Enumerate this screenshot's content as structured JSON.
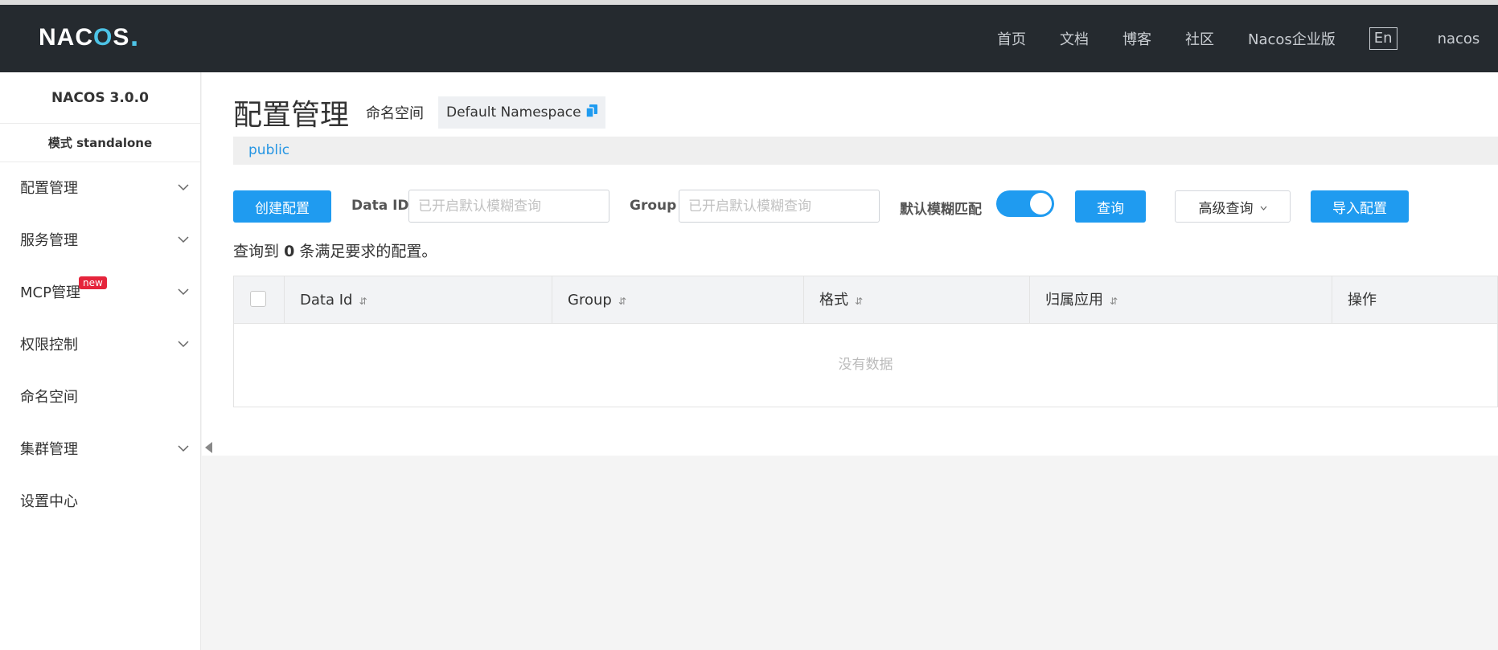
{
  "header": {
    "logo": "NACOS.",
    "nav": [
      "首页",
      "文档",
      "博客",
      "社区",
      "Nacos企业版"
    ],
    "lang": "En",
    "user": "nacos"
  },
  "sidebar": {
    "version": "NACOS 3.0.0",
    "mode": "模式 standalone",
    "items": [
      {
        "label": "配置管理",
        "expandable": true
      },
      {
        "label": "服务管理",
        "expandable": true
      },
      {
        "label": "MCP管理",
        "expandable": true,
        "badge": "new"
      },
      {
        "label": "权限控制",
        "expandable": true
      },
      {
        "label": "命名空间",
        "expandable": false
      },
      {
        "label": "集群管理",
        "expandable": true
      },
      {
        "label": "设置中心",
        "expandable": false
      }
    ]
  },
  "main": {
    "title": "配置管理",
    "namespace_label": "命名空间",
    "namespace_value": "Default Namespace",
    "namespace_tab": "public",
    "create_button": "创建配置",
    "dataid_label": "Data ID",
    "dataid_placeholder": "已开启默认模糊查询",
    "group_label": "Group",
    "group_placeholder": "已开启默认模糊查询",
    "fuzzy_label": "默认模糊匹配",
    "fuzzy_on": true,
    "query_button": "查询",
    "advanced_button": "高级查询",
    "import_button": "导入配置",
    "result_prefix": "查询到",
    "result_count": "0",
    "result_suffix": "条满足要求的配置。",
    "table": {
      "columns": [
        "Data Id",
        "Group",
        "格式",
        "归属应用",
        "操作"
      ],
      "empty_text": "没有数据"
    }
  },
  "colors": {
    "header_bg": "#252a2f",
    "primary": "#1f9bf0",
    "badge": "#e5243b",
    "link": "#2495e3"
  }
}
